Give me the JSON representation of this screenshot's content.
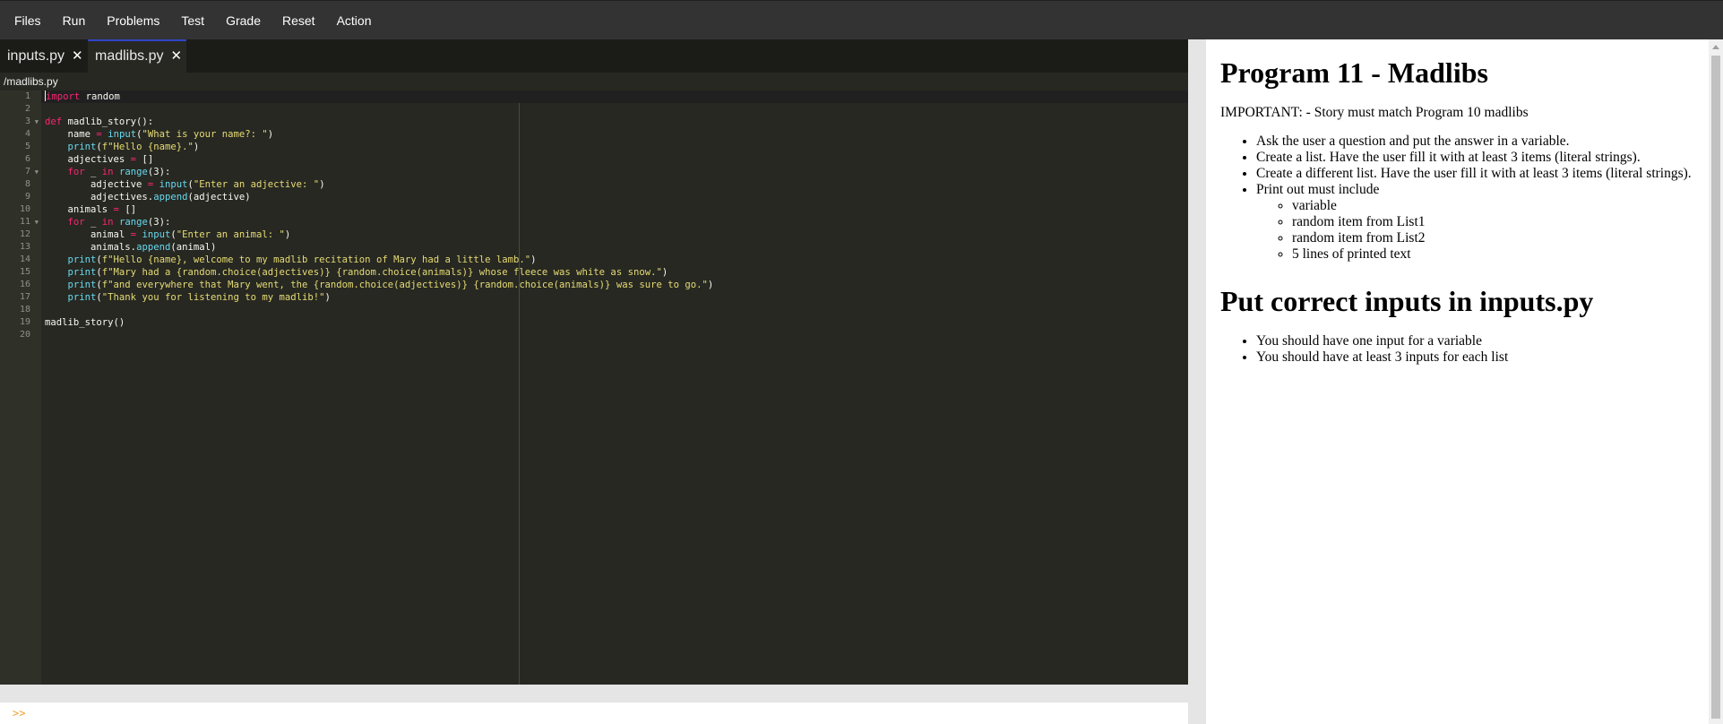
{
  "menu": [
    "Files",
    "Run",
    "Problems",
    "Test",
    "Grade",
    "Reset",
    "Action"
  ],
  "tabs": [
    {
      "label": "inputs.py",
      "close": "✕"
    },
    {
      "label": "madlibs.py",
      "close": "✕"
    }
  ],
  "path": "/madlibs.py",
  "line_numbers": [
    "1",
    "2",
    "3",
    "4",
    "5",
    "6",
    "7",
    "8",
    "9",
    "10",
    "11",
    "12",
    "13",
    "14",
    "15",
    "16",
    "17",
    "18",
    "19",
    "20"
  ],
  "code_lines": [
    "import random",
    "",
    "def madlib_story():",
    "    name = input(\"What is your name?: \")",
    "    print(f\"Hello {name}.\")",
    "    adjectives = []",
    "    for _ in range(3):",
    "        adjective = input(\"Enter an adjective: \")",
    "        adjectives.append(adjective)",
    "    animals = []",
    "    for _ in range(3):",
    "        animal = input(\"Enter an animal: \")",
    "        animals.append(animal)",
    "    print(f\"Hello {name}, welcome to my madlib recitation of Mary had a little lamb.\")",
    "    print(f\"Mary had a {random.choice(adjectives)} {random.choice(animals)} whose fleece was white as snow.\")",
    "    print(f\"and everywhere that Mary went, the {random.choice(adjectives)} {random.choice(animals)} was sure to go.\")",
    "    print(\"Thank you for listening to my madlib!\")",
    "",
    "madlib_story()",
    ""
  ],
  "console_prompt": ">>",
  "instructions": {
    "title": "Program 11 - Madlibs",
    "important": "IMPORTANT: - Story must match Program 10 madlibs",
    "bullets": [
      "Ask the user a question and put the answer in a variable.",
      "Create a list. Have the user fill it with at least 3 items (literal strings).",
      "Create a different list. Have the user fill it with at least 3 items (literal strings).",
      "Print out must include"
    ],
    "sub_bullets": [
      "variable",
      "random item from List1",
      "random item from List2",
      "5 lines of printed text"
    ],
    "heading2": "Put correct inputs in inputs.py",
    "bullets2": [
      "You should have one input for a variable",
      "You should have at least 3 inputs for each list"
    ]
  },
  "colors": {
    "editor_bg": "#272822",
    "keyword": "#f92672",
    "string": "#e6db74",
    "builtin": "#66d9ef",
    "tab_active_border": "#2f45c8",
    "menubar_bg": "#333333"
  }
}
